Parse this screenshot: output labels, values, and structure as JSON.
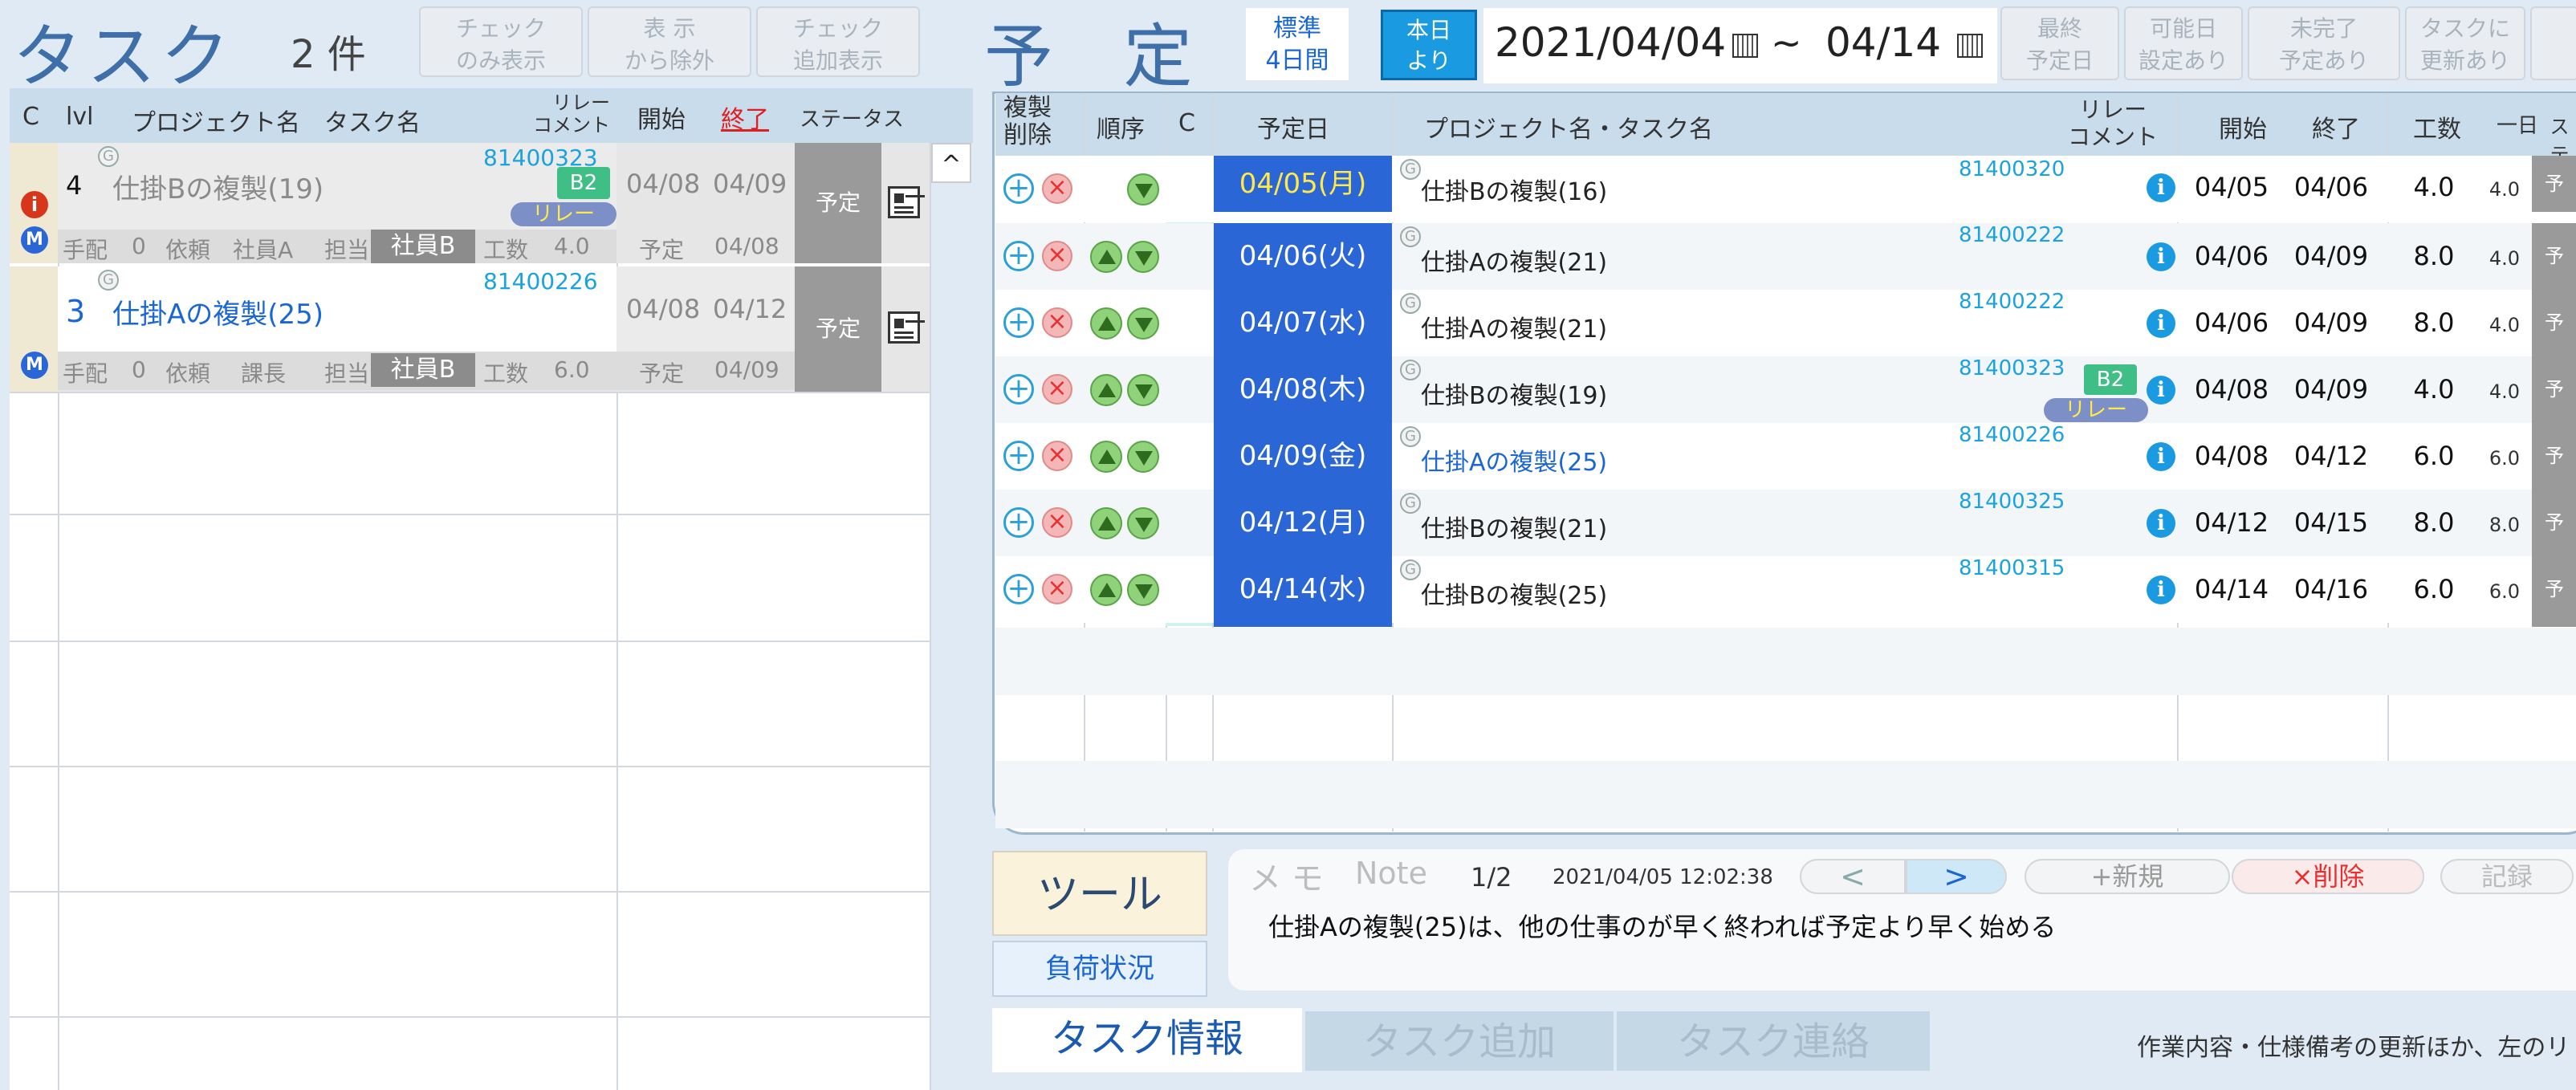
{
  "left": {
    "title": "タスク",
    "count": "2 件",
    "buttons": [
      "チェック\nのみ表示",
      "表 示\nから除外",
      "チェック\n追加表示"
    ],
    "headers": {
      "c": "C",
      "lvl": "lvl",
      "project": "プロジェクト名",
      "task": "タスク名",
      "relay": "リレー\nコメント",
      "start": "開始",
      "end": "終了",
      "status": "ステータス"
    },
    "rows": [
      {
        "lvl": "4",
        "name": "仕掛Bの複製(19)",
        "code": "81400323",
        "badge": "B2",
        "relay": "リレー",
        "start": "04/08",
        "end": "04/09",
        "status": "予定",
        "sub": {
          "prep_label": "手配",
          "prep": "0",
          "req_label": "依頼",
          "req": "社員A",
          "assign_label": "担当",
          "assign": "社員B",
          "man_label": "工数",
          "man": "4.0",
          "plan_label": "予定",
          "plan": "04/08"
        }
      },
      {
        "lvl": "3",
        "name": "仕掛Aの複製(25)",
        "code": "81400226",
        "start": "04/08",
        "end": "04/12",
        "status": "予定",
        "sub": {
          "prep_label": "手配",
          "prep": "0",
          "req_label": "依頼",
          "req": "課長",
          "assign_label": "担当",
          "assign": "社員B",
          "man_label": "工数",
          "man": "6.0",
          "plan_label": "予定",
          "plan": "04/09"
        }
      }
    ],
    "icons": {
      "info": "i",
      "m": "M",
      "g": "G",
      "collapse": "^"
    }
  },
  "right": {
    "title": "予 定",
    "standard": "標準\n4日間",
    "today": "本日\nより",
    "date_from": "2021/04/04",
    "tilde": "~",
    "date_to": "04/14",
    "filters": [
      "最終\n予定日",
      "可能日\n設定あり",
      "未完了\n予定あり",
      "タスクに\n更新あり"
    ],
    "headers": {
      "dup": "複製\n削除",
      "order": "順序",
      "c": "C",
      "date": "予定日",
      "name": "プロジェクト名・タスク名",
      "relay": "リレー\nコメント",
      "start": "開始",
      "end": "終了",
      "man": "工数",
      "day": "一日",
      "status": "ステー"
    },
    "rows": [
      {
        "date": "04/05(月)",
        "name": "仕掛Bの複製(16)",
        "code": "81400320",
        "start": "04/05",
        "end": "04/06",
        "man": "4.0",
        "day": "4.0",
        "st": "予"
      },
      {
        "date": "04/06(火)",
        "name": "仕掛Aの複製(21)",
        "code": "81400222",
        "start": "04/06",
        "end": "04/09",
        "man": "8.0",
        "day": "4.0",
        "st": "予"
      },
      {
        "date": "04/07(水)",
        "name": "仕掛Aの複製(21)",
        "code": "81400222",
        "start": "04/06",
        "end": "04/09",
        "man": "8.0",
        "day": "4.0",
        "st": "予"
      },
      {
        "date": "04/08(木)",
        "name": "仕掛Bの複製(19)",
        "code": "81400323",
        "badge": "B2",
        "relay": "リレー",
        "start": "04/08",
        "end": "04/09",
        "man": "4.0",
        "day": "4.0",
        "st": "予"
      },
      {
        "date": "04/09(金)",
        "name": "仕掛Aの複製(25)",
        "code": "81400226",
        "start": "04/08",
        "end": "04/12",
        "man": "6.0",
        "day": "6.0",
        "st": "予"
      },
      {
        "date": "04/12(月)",
        "name": "仕掛Bの複製(21)",
        "code": "81400325",
        "start": "04/12",
        "end": "04/15",
        "man": "8.0",
        "day": "8.0",
        "st": "予"
      },
      {
        "date": "04/14(水)",
        "name": "仕掛Bの複製(25)",
        "code": "81400315",
        "start": "04/14",
        "end": "04/16",
        "man": "6.0",
        "day": "6.0",
        "st": "予"
      }
    ],
    "tool": "ツール",
    "load": "負荷状況",
    "memo": {
      "label1": "メ モ",
      "label2": "Note",
      "page": "1/2",
      "timestamp": "2021/04/05 12:02:38",
      "prev": "<",
      "next": ">",
      "new": "+新規",
      "delete": "×削除",
      "record": "記録",
      "text": "仕掛Aの複製(25)は、他の仕事のが早く終われば予定より早く始める"
    },
    "tabs": [
      "タスク情報",
      "タスク追加",
      "タスク連絡"
    ],
    "tab_desc": "作業内容・仕様備考の更新ほか、左のリ"
  }
}
